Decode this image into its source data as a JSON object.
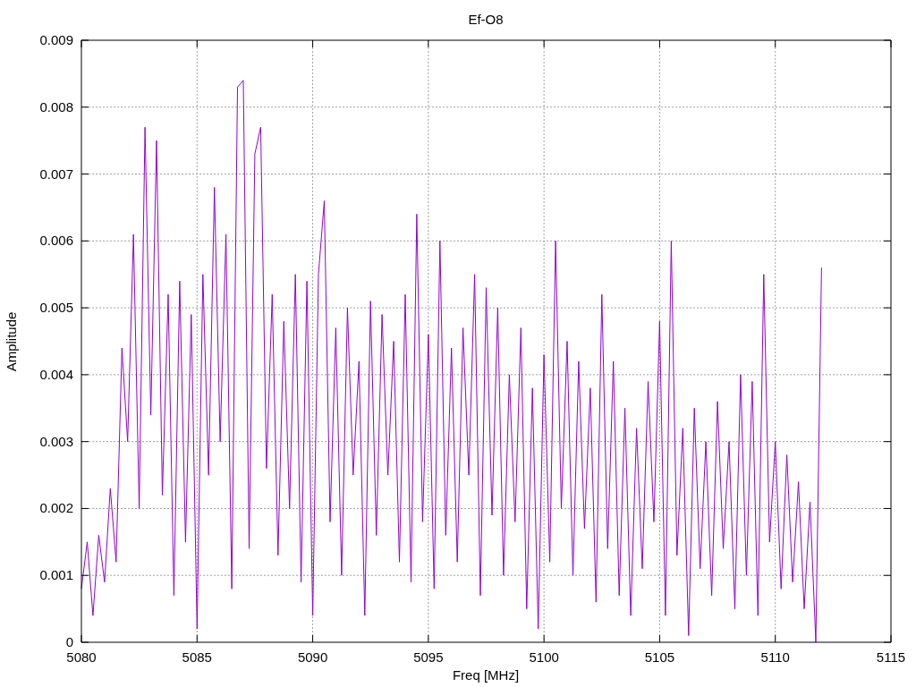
{
  "plot": {
    "chart_data": {
      "type": "line",
      "grid": true,
      "title": "Ef-O8",
      "xlabel": "Freq [MHz]",
      "ylabel": "Amplitude",
      "xlim": [
        5080,
        5115
      ],
      "ylim": [
        0,
        0.009
      ],
      "xticks": [
        5080,
        5085,
        5090,
        5095,
        5100,
        5105,
        5110,
        5115
      ],
      "yticks": [
        0.009,
        0.008,
        0.007,
        0.006,
        0.005,
        0.004,
        0.003,
        0.002,
        0.001,
        0
      ],
      "x": [
        5080,
        5080.25,
        5080.5,
        5080.75,
        5081,
        5081.25,
        5081.5,
        5081.75,
        5082,
        5082.25,
        5082.5,
        5082.75,
        5083,
        5083.25,
        5083.5,
        5083.75,
        5084,
        5084.25,
        5084.5,
        5084.75,
        5085,
        5085.25,
        5085.5,
        5085.75,
        5086,
        5086.25,
        5086.5,
        5086.75,
        5087,
        5087.25,
        5087.5,
        5087.75,
        5088,
        5088.25,
        5088.5,
        5088.75,
        5089,
        5089.25,
        5089.5,
        5089.75,
        5090,
        5090.25,
        5090.5,
        5090.75,
        5091,
        5091.25,
        5091.5,
        5091.75,
        5092,
        5092.25,
        5092.5,
        5092.75,
        5093,
        5093.25,
        5093.5,
        5093.75,
        5094,
        5094.25,
        5094.5,
        5094.75,
        5095,
        5095.25,
        5095.5,
        5095.75,
        5096,
        5096.25,
        5096.5,
        5096.75,
        5097,
        5097.25,
        5097.5,
        5097.75,
        5098,
        5098.25,
        5098.5,
        5098.75,
        5099,
        5099.25,
        5099.5,
        5099.75,
        5100,
        5100.25,
        5100.5,
        5100.75,
        5101,
        5101.25,
        5101.5,
        5101.75,
        5102,
        5102.25,
        5102.5,
        5102.75,
        5103,
        5103.25,
        5103.5,
        5103.75,
        5104,
        5104.25,
        5104.5,
        5104.75,
        5105,
        5105.25,
        5105.5,
        5105.75,
        5106,
        5106.25,
        5106.5,
        5106.75,
        5107,
        5107.25,
        5107.5,
        5107.75,
        5108,
        5108.25,
        5108.5,
        5108.75,
        5109,
        5109.25,
        5109.5,
        5109.75,
        5110,
        5110.25,
        5110.5,
        5110.75,
        5111,
        5111.25,
        5111.5,
        5111.75,
        5112
      ],
      "series": [
        {
          "color": "#9400d3",
          "values": [
            0.0008,
            0.0015,
            0.0004,
            0.0016,
            0.0009,
            0.0023,
            0.0012,
            0.0044,
            0.003,
            0.0061,
            0.002,
            0.0077,
            0.0034,
            0.0075,
            0.0022,
            0.0052,
            0.0007,
            0.0054,
            0.0015,
            0.0049,
            0.0002,
            0.0055,
            0.0025,
            0.0068,
            0.003,
            0.0061,
            0.0008,
            0.0083,
            0.0084,
            0.0014,
            0.0073,
            0.0077,
            0.0026,
            0.0052,
            0.0013,
            0.0048,
            0.002,
            0.0055,
            0.0009,
            0.0054,
            0.0004,
            0.0055,
            0.0066,
            0.0018,
            0.0047,
            0.001,
            0.005,
            0.0025,
            0.0042,
            0.0004,
            0.0051,
            0.0016,
            0.0049,
            0.0025,
            0.0045,
            0.0012,
            0.0052,
            0.0009,
            0.0064,
            0.0018,
            0.0046,
            0.0008,
            0.006,
            0.0016,
            0.0044,
            0.0012,
            0.0047,
            0.0025,
            0.0055,
            0.0007,
            0.0053,
            0.0019,
            0.005,
            0.001,
            0.004,
            0.0018,
            0.0047,
            0.0005,
            0.0038,
            0.0002,
            0.0043,
            0.0012,
            0.006,
            0.002,
            0.0045,
            0.001,
            0.0042,
            0.0017,
            0.0038,
            0.0006,
            0.0052,
            0.0014,
            0.0042,
            0.0007,
            0.0035,
            0.0004,
            0.0032,
            0.0011,
            0.0039,
            0.0018,
            0.0048,
            0.0004,
            0.006,
            0.0013,
            0.0032,
            0.0001,
            0.0035,
            0.0011,
            0.003,
            0.0007,
            0.0036,
            0.0014,
            0.003,
            0.0005,
            0.004,
            0.001,
            0.0039,
            0.0004,
            0.0055,
            0.0015,
            0.003,
            0.0008,
            0.0028,
            0.0009,
            0.0024,
            0.0005,
            0.0021,
            0,
            0.0056
          ]
        }
      ]
    }
  }
}
